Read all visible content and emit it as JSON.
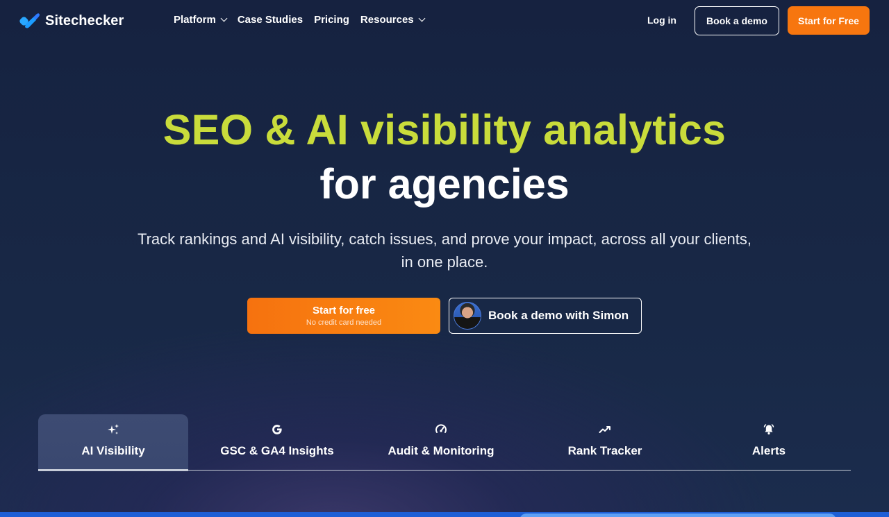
{
  "nav": {
    "brand": "Sitechecker",
    "menu": [
      {
        "label": "Platform",
        "has_dropdown": true
      },
      {
        "label": "Case Studies",
        "has_dropdown": false
      },
      {
        "label": "Pricing",
        "has_dropdown": false
      },
      {
        "label": "Resources",
        "has_dropdown": true
      }
    ],
    "login": "Log in",
    "book_demo": "Book a demo",
    "start_free": "Start for Free"
  },
  "hero": {
    "title_line1": "SEO & AI visibility analytics",
    "title_line2": "for agencies",
    "subtitle": "Track rankings and AI visibility, catch issues, and prove your impact, across all your clients, in one place.",
    "cta_primary_label": "Start for free",
    "cta_primary_sub": "No credit card needed",
    "cta_secondary_label": "Book a demo with Simon"
  },
  "tabs": [
    {
      "label": "AI Visibility",
      "icon": "sparkles-icon",
      "active": true
    },
    {
      "label": "GSC & GA4 Insights",
      "icon": "google-icon",
      "active": false
    },
    {
      "label": "Audit & Monitoring",
      "icon": "gauge-icon",
      "active": false
    },
    {
      "label": "Rank Tracker",
      "icon": "trend-line-icon",
      "active": false
    },
    {
      "label": "Alerts",
      "icon": "bell-icon",
      "active": false
    }
  ],
  "colors": {
    "background": "#162240",
    "accent_yellow": "#c9dc3b",
    "accent_orange": "#f7760f",
    "active_tab": "#3d4b72",
    "bottom_blue": "#1e5fd6"
  }
}
